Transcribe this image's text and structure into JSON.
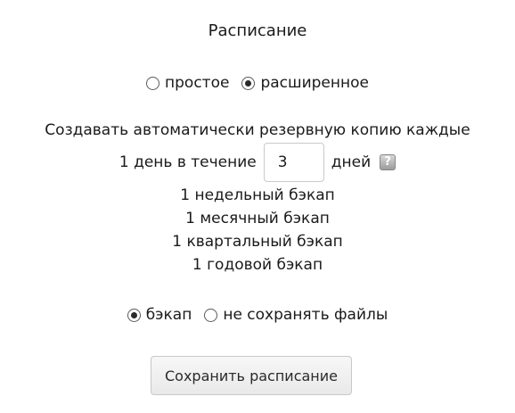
{
  "schedule": {
    "title": "Расписание",
    "mode_options": [
      {
        "label": "простое",
        "selected": false
      },
      {
        "label": "расширенное",
        "selected": true
      }
    ],
    "description": "Создавать автоматически резервную копию каждые",
    "days_prefix": "1 день в течение",
    "days_value": "3",
    "days_suffix": "дней",
    "help_icon": "?",
    "retention": [
      "1 недельный бэкап",
      "1 месячный бэкап",
      "1 квартальный бэкап",
      "1 годовой бэкап"
    ],
    "storage_options": [
      {
        "label": "бэкап",
        "selected": true
      },
      {
        "label": "не сохранять файлы",
        "selected": false
      }
    ],
    "save_label": "Сохранить расписание"
  }
}
